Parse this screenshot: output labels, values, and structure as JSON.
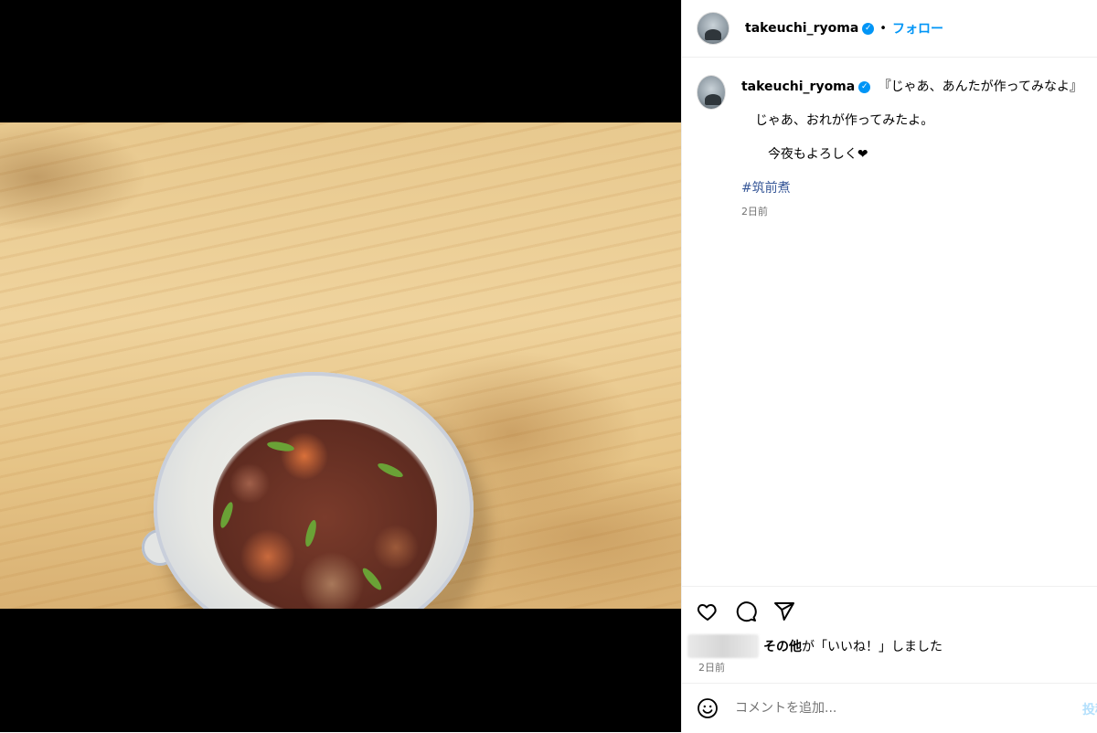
{
  "post": {
    "username": "takeuchi_ryoma",
    "follow_label": "フォロー",
    "separator": "•"
  },
  "caption": {
    "username": "takeuchi_ryoma",
    "line1": "『じゃあ、あんたが作ってみなよ』",
    "line2": "じゃあ、おれが作ってみたよ。",
    "line3": "今夜もよろしく❤",
    "hashtag": "#筑前煮",
    "time": "2日前"
  },
  "engagement": {
    "likes_bold": "その他",
    "likes_text": "が「いいね！」しました",
    "time": "2日前"
  },
  "comment": {
    "placeholder": "コメントを追加...",
    "post_label": "投稿する"
  },
  "icons": {
    "like": "heart-icon",
    "comment": "comment-icon",
    "share": "share-icon",
    "emoji": "emoji-icon",
    "verified": "verified-badge-icon"
  },
  "colors": {
    "accent": "#0095f6",
    "hashtag": "#385898",
    "muted": "#737373",
    "post_disabled": "#b2dffc"
  }
}
